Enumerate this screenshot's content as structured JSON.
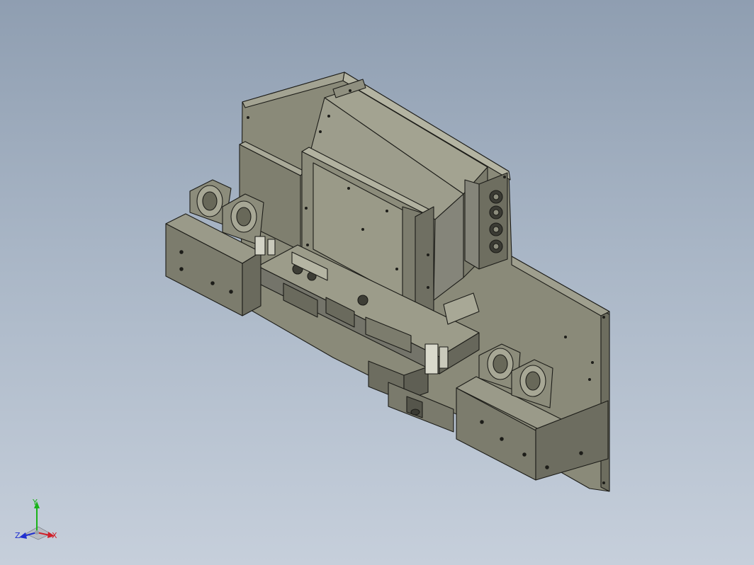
{
  "viewport": {
    "background_top": "#8f9eb1",
    "background_bottom": "#c6cfdb",
    "model_name": "",
    "model_color": "#8e8e7c"
  },
  "triad": {
    "x_label": "X",
    "y_label": "Y",
    "z_label": "Z",
    "x_color": "#d0202a",
    "y_color": "#19b319",
    "z_color": "#2030d0"
  }
}
